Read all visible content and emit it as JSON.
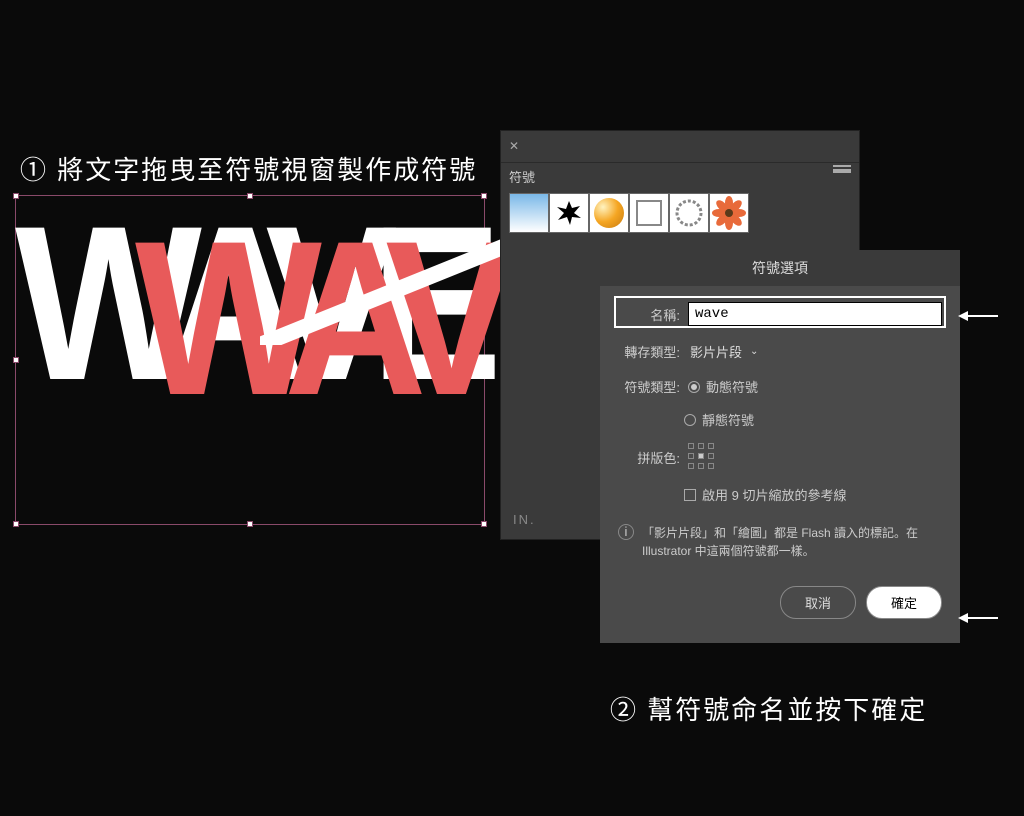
{
  "annotations": {
    "step1": "① 將文字拖曳至符號視窗製作成符號",
    "step2": "② 幫符號命名並按下確定"
  },
  "canvas": {
    "text_white": "WAVE",
    "text_red": "WAVE"
  },
  "symbols_panel": {
    "title": "符號",
    "thumbs": [
      "gradient",
      "splat",
      "sphere",
      "square",
      "ring",
      "flower"
    ],
    "iconbar": "IN."
  },
  "dialog": {
    "title": "符號選項",
    "name_label": "名稱:",
    "name_value": "wave",
    "export_type_label": "轉存類型:",
    "export_type_value": "影片片段",
    "symbol_type_label": "符號類型:",
    "symbol_type_dynamic": "動態符號",
    "symbol_type_static": "靜態符號",
    "registration_label": "拼版色:",
    "slice_checkbox": "啟用 9 切片縮放的參考線",
    "info_text": "「影片片段」和「繪圖」都是 Flash 讀入的標記。在 Illustrator 中這兩個符號都一樣。",
    "cancel": "取消",
    "ok": "確定"
  }
}
